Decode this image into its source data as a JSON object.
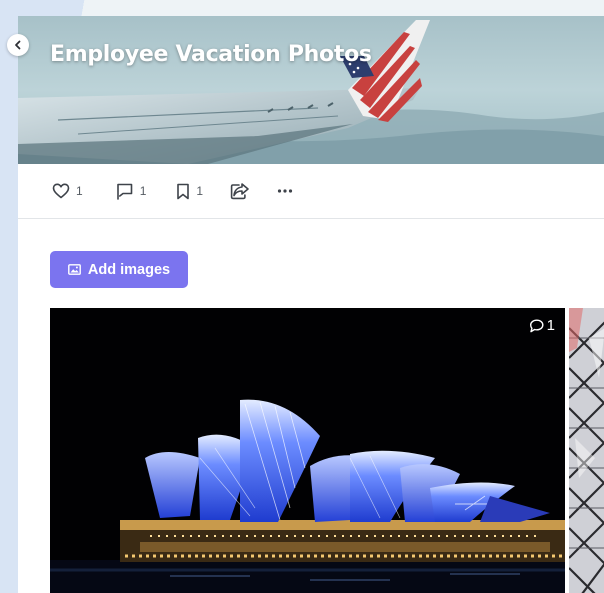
{
  "page": {
    "title": "Employee Vacation Photos"
  },
  "sidebar": {
    "collapse_icon": "chevron-left-icon"
  },
  "actions": {
    "like": {
      "icon": "heart-icon",
      "count": "1"
    },
    "flag": {
      "icon": "flag-icon",
      "count": "1"
    },
    "bookmark": {
      "icon": "bookmark-icon",
      "count": "1"
    },
    "share": {
      "icon": "share-icon"
    },
    "more": {
      "icon": "more-horizontal-icon"
    }
  },
  "gallery": {
    "add_button_label": "Add images",
    "add_button_icon": "image-icon",
    "photos": [
      {
        "subject": "Sydney Opera House at night",
        "comment_count": "1"
      },
      {
        "subject": "Glass lattice structure"
      }
    ]
  },
  "colors": {
    "accent": "#7b74ef",
    "sidebar": "#d8e4f4",
    "text": "#4a4f56"
  }
}
